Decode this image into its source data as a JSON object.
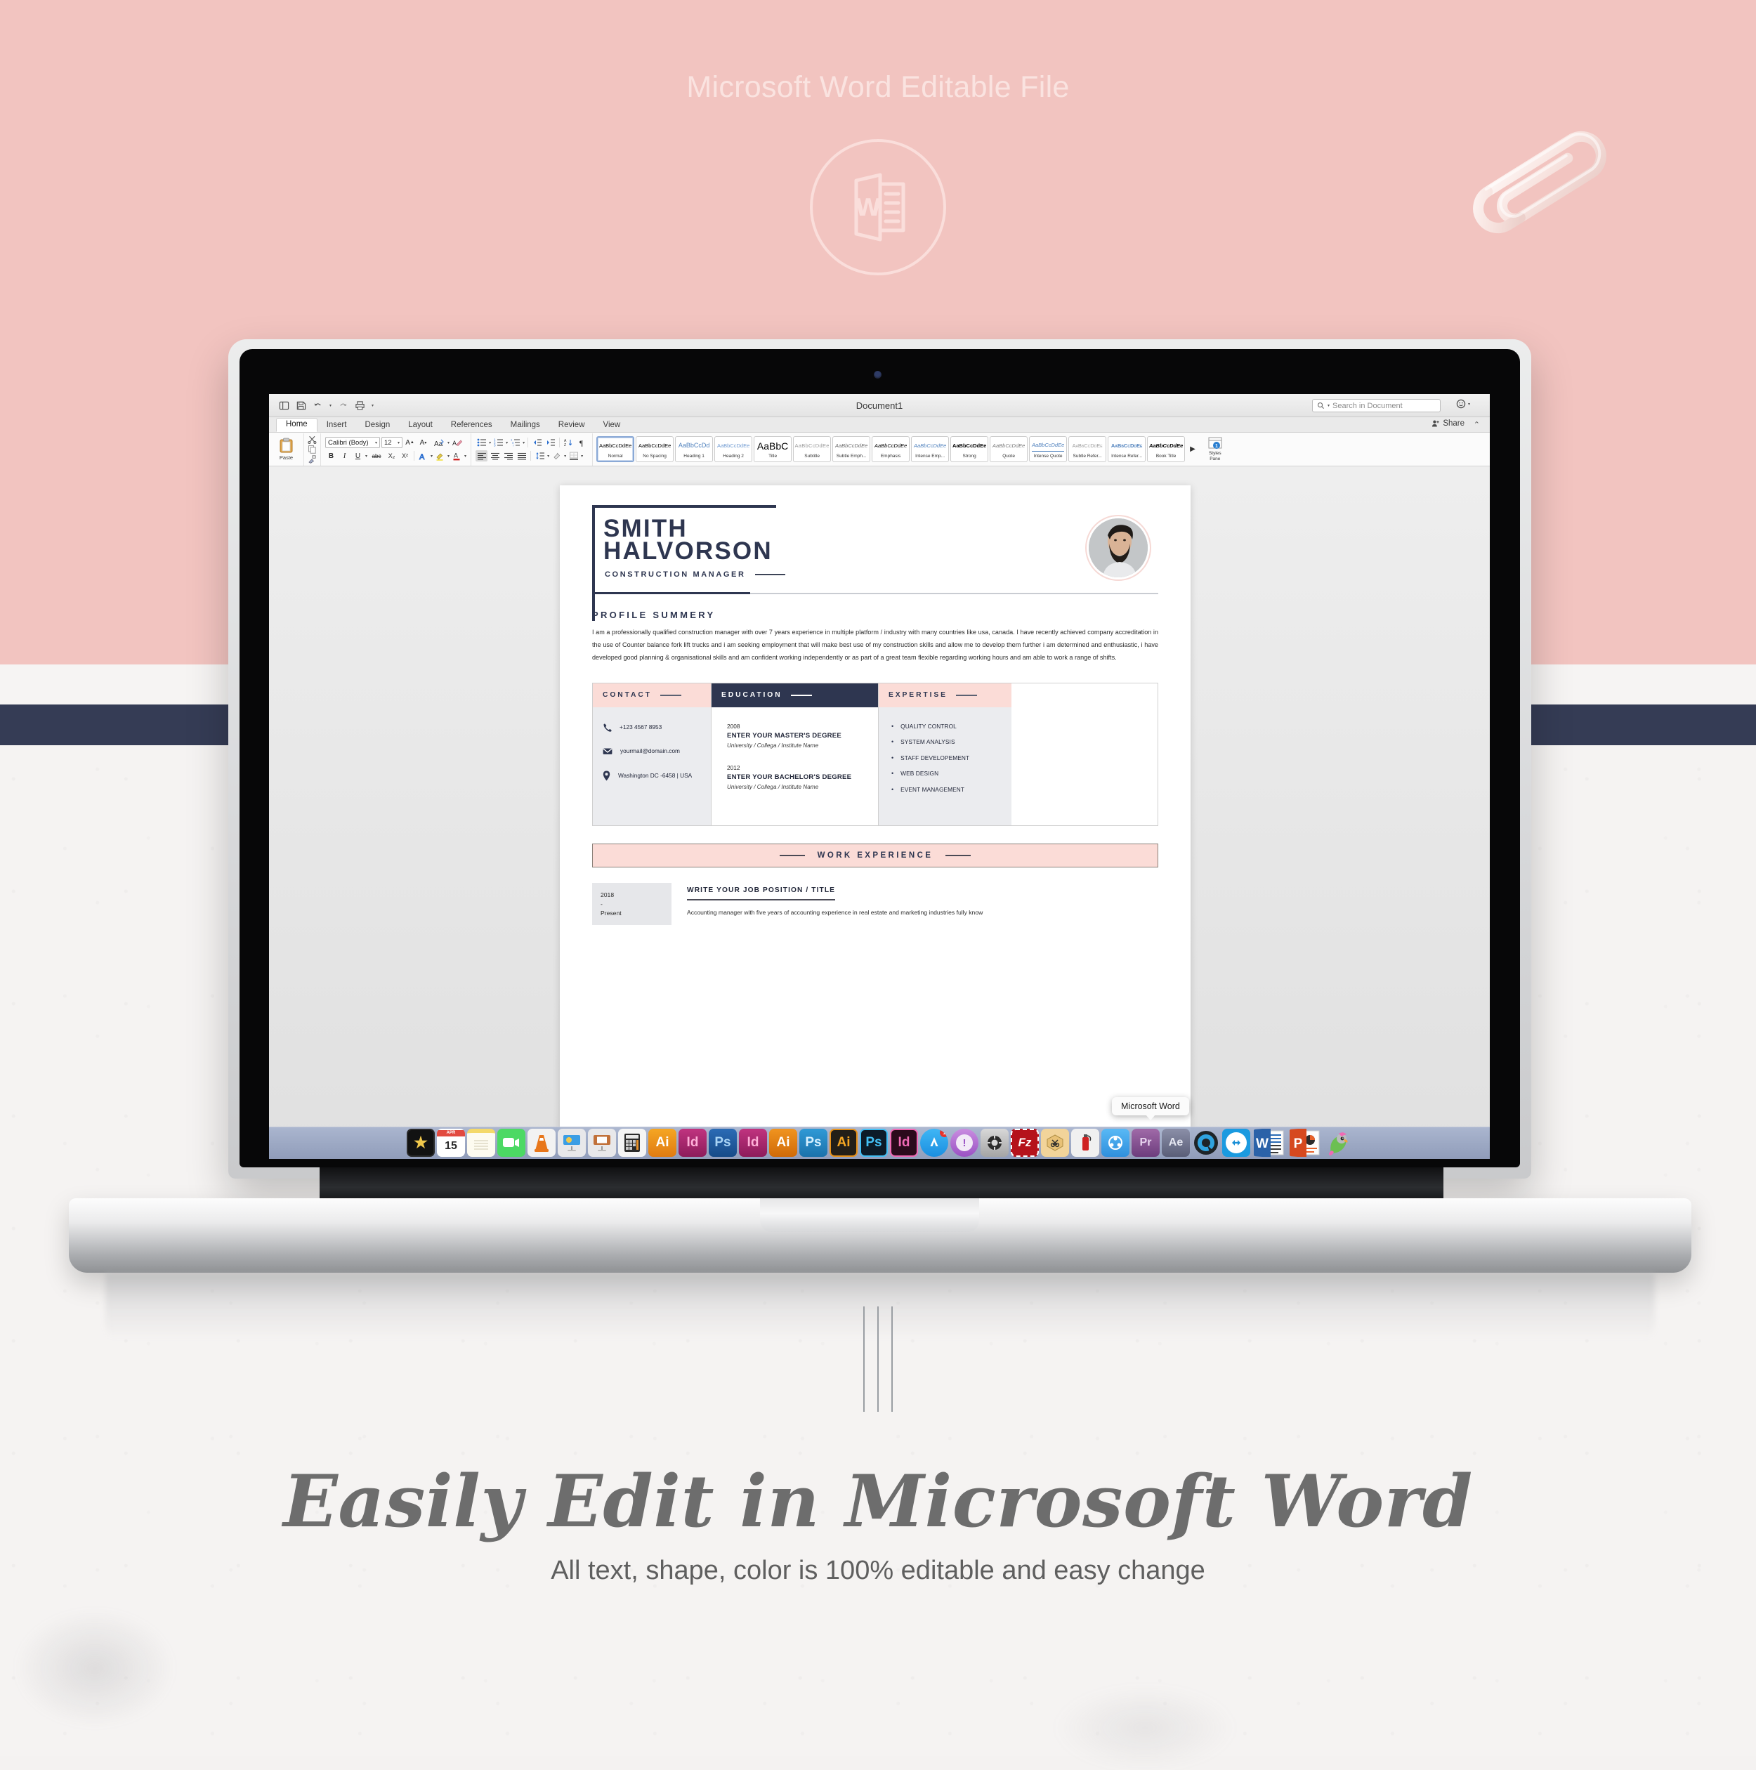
{
  "header": {
    "title": "Microsoft Word Editable File",
    "badge_icon": "word-document-icon"
  },
  "decor": {
    "paperclip_icon": "paperclip-icon"
  },
  "word": {
    "document_title": "Document1",
    "quick_access": [
      "sidebar-toggle-icon",
      "save-icon",
      "undo-icon",
      "redo-icon",
      "print-icon",
      "customize-caret-icon"
    ],
    "search": {
      "placeholder": "Search in Document",
      "icon": "search-icon"
    },
    "smiley_icon": "smiley-face-icon",
    "share_label": "Share",
    "share_icon": "person-add-icon",
    "collapse_icon": "chevron-up-icon",
    "tabs": [
      "Home",
      "Insert",
      "Design",
      "Layout",
      "References",
      "Mailings",
      "Review",
      "View"
    ],
    "active_tab": "Home",
    "clipboard": {
      "paste_label": "Paste",
      "paste_icon": "clipboard-icon",
      "cut_icon": "scissors-icon",
      "copy_icon": "copy-icon",
      "format_painter_icon": "paintbrush-icon"
    },
    "font": {
      "name": "Calibri (Body)",
      "size": "12",
      "grow_icon": "grow-font-icon",
      "shrink_icon": "shrink-font-icon",
      "change_case_icon": "change-case-icon",
      "clear_format_icon": "clear-formatting-icon",
      "bold_label": "B",
      "italic_label": "I",
      "underline_label": "U",
      "strike_label": "abc",
      "subscript_label": "X₂",
      "superscript_label": "X²",
      "text_effects_icon": "text-effects-icon",
      "highlight_icon": "highlight-color-icon",
      "font_color_icon": "font-color-icon"
    },
    "paragraph": {
      "bullets_icon": "bulleted-list-icon",
      "numbering_icon": "numbered-list-icon",
      "multilevel_icon": "multilevel-list-icon",
      "decrease_indent_icon": "decrease-indent-icon",
      "increase_indent_icon": "increase-indent-icon",
      "sort_icon": "sort-az-icon",
      "marks_icon": "paragraph-marks-icon",
      "align_left_icon": "align-left-icon",
      "align_center_icon": "align-center-icon",
      "align_right_icon": "align-right-icon",
      "justify_icon": "justify-icon",
      "line_spacing_icon": "line-spacing-icon",
      "shading_icon": "shading-icon",
      "borders_icon": "borders-icon"
    },
    "styles": {
      "items": [
        {
          "preview": "AaBbCcDdEe",
          "name": "Normal",
          "selected": true
        },
        {
          "preview": "AaBbCcDdEe",
          "name": "No Spacing",
          "selected": false
        },
        {
          "preview": "AaBbCcDd",
          "name": "Heading 1",
          "selected": false
        },
        {
          "preview": "AaBbCcDdEe",
          "name": "Heading 2",
          "selected": false
        },
        {
          "preview": "AaBbC",
          "name": "Title",
          "selected": false
        },
        {
          "preview": "AaBbCcDdEe",
          "name": "Subtitle",
          "selected": false
        },
        {
          "preview": "AaBbCcDdEe",
          "name": "Subtle Emph...",
          "selected": false
        },
        {
          "preview": "AaBbCcDdEe",
          "name": "Emphasis",
          "selected": false
        },
        {
          "preview": "AaBbCcDdEe",
          "name": "Intense Emp...",
          "selected": false
        },
        {
          "preview": "AaBbCcDdEe",
          "name": "Strong",
          "selected": false
        },
        {
          "preview": "AaBbCcDdEe",
          "name": "Quote",
          "selected": false
        },
        {
          "preview": "AaBbCcDdEe",
          "name": "Intense Quote",
          "selected": false
        },
        {
          "preview": "AaBbCcDdEe",
          "name": "Subtle Refer...",
          "selected": false
        },
        {
          "preview": "AaBbCcDdEe",
          "name": "Intense Refer...",
          "selected": false
        },
        {
          "preview": "AaBbCcDdEe",
          "name": "Book Title",
          "selected": false
        }
      ],
      "more_icon": "chevron-right-icon",
      "pane_label_line1": "Styles",
      "pane_label_line2": "Pane",
      "pane_icon": "styles-pane-icon"
    }
  },
  "resume": {
    "first_name": "SMITH",
    "last_name": "HALVORSON",
    "job_title": "CONSTRUCTION MANAGER",
    "avatar_icon": "profile-photo",
    "profile": {
      "heading": "PROFILE SUMMERY",
      "body": "I am a professionally qualified construction manager with over 7 years experience in multiple platform / industry with many countries like usa, canada. I have recently achieved company accreditation in the use of Counter balance fork lift trucks and i am seeking employment that will make best use of my construction skills and allow me to develop them further i am determined and enthusiastic, i have developed good planning & organisational skills and am confident working independently or as part of a great team flexible regarding working hours and am able to work a range of shifts."
    },
    "contact": {
      "heading": "CONTACT",
      "rows": [
        {
          "icon": "phone-icon",
          "text": "+123 4567 8953"
        },
        {
          "icon": "envelope-icon",
          "text": "yourmail@domain.com"
        },
        {
          "icon": "location-pin-icon",
          "text": "Washington DC -6458 | USA"
        }
      ]
    },
    "education": {
      "heading": "EDUCATION",
      "entries": [
        {
          "year": "2008",
          "degree": "ENTER YOUR MASTER'S DEGREE",
          "school": "University / Collega / Institute Name"
        },
        {
          "year": "2012",
          "degree": "ENTER YOUR BACHELOR'S DEGREE",
          "school": "University / Collega / Institute Name"
        }
      ]
    },
    "expertise": {
      "heading": "EXPERTISE",
      "items": [
        "QUALITY CONTROL",
        "SYSTEM ANALYSIS",
        "STAFF DEVELOPEMENT",
        "WEB DESIGN",
        "EVENT MANAGEMENT"
      ]
    },
    "work": {
      "banner": "WORK EXPERIENCE",
      "date_line1": "2018",
      "date_line2": "-",
      "date_line3": "Present",
      "position": "WRITE YOUR JOB POSITION / TITLE",
      "description": "Accounting manager with five years of accounting experience in real estate and marketing industries fully know"
    }
  },
  "dock": {
    "tooltip": "Microsoft Word",
    "items": [
      {
        "name": "imovie",
        "label": "",
        "icon": "imovie-icon"
      },
      {
        "name": "calendar",
        "label": "15",
        "icon": "calendar-icon"
      },
      {
        "name": "notes",
        "label": "",
        "icon": "notes-icon"
      },
      {
        "name": "facetime",
        "label": "",
        "icon": "facetime-icon"
      },
      {
        "name": "vlc",
        "label": "",
        "icon": "vlc-cone-icon"
      },
      {
        "name": "keynote",
        "label": "",
        "icon": "keynote-icon"
      },
      {
        "name": "pages",
        "label": "",
        "icon": "pages-icon"
      },
      {
        "name": "numbers",
        "label": "",
        "icon": "numbers-icon"
      },
      {
        "name": "illustrator-1",
        "label": "Ai",
        "icon": "adobe-illustrator-icon"
      },
      {
        "name": "indesign-1",
        "label": "Id",
        "icon": "adobe-indesign-icon"
      },
      {
        "name": "photoshop-1",
        "label": "Ps",
        "icon": "adobe-photoshop-icon"
      },
      {
        "name": "indesign-2",
        "label": "Id",
        "icon": "adobe-indesign-icon"
      },
      {
        "name": "illustrator-2",
        "label": "Ai",
        "icon": "adobe-illustrator-icon"
      },
      {
        "name": "photoshop-2",
        "label": "Ps",
        "icon": "adobe-photoshop-icon"
      },
      {
        "name": "illustrator-3",
        "label": "Ai",
        "icon": "adobe-illustrator-icon"
      },
      {
        "name": "photoshop-3",
        "label": "Ps",
        "icon": "adobe-photoshop-icon"
      },
      {
        "name": "indesign-3",
        "label": "Id",
        "icon": "adobe-indesign-icon"
      },
      {
        "name": "app-store",
        "label": "A",
        "icon": "app-store-icon"
      },
      {
        "name": "skype",
        "label": "!",
        "icon": "skype-icon"
      },
      {
        "name": "system-preferences",
        "label": "",
        "icon": "gear-icon"
      },
      {
        "name": "filezilla",
        "label": "Fz",
        "icon": "filezilla-icon"
      },
      {
        "name": "unarchiver",
        "label": "",
        "icon": "unarchiver-box-icon"
      },
      {
        "name": "fire-extinguisher",
        "label": "",
        "icon": "fire-extinguisher-icon"
      },
      {
        "name": "sharing",
        "label": "",
        "icon": "share-nodes-icon"
      },
      {
        "name": "premiere",
        "label": "Pr",
        "icon": "adobe-premiere-icon"
      },
      {
        "name": "after-effects",
        "label": "Ae",
        "icon": "adobe-after-effects-icon"
      },
      {
        "name": "quicktime",
        "label": "Q",
        "icon": "quicktime-icon"
      },
      {
        "name": "teamviewer",
        "label": "",
        "icon": "teamviewer-icon"
      },
      {
        "name": "microsoft-word",
        "label": "W",
        "icon": "microsoft-word-icon"
      },
      {
        "name": "powerpoint",
        "label": "P",
        "icon": "microsoft-powerpoint-icon"
      },
      {
        "name": "parrot",
        "label": "",
        "icon": "parrot-icon"
      }
    ]
  },
  "footer": {
    "headline": "Easily Edit in Microsoft Word",
    "subline": "All text, shape, color is 100% editable and easy change"
  }
}
